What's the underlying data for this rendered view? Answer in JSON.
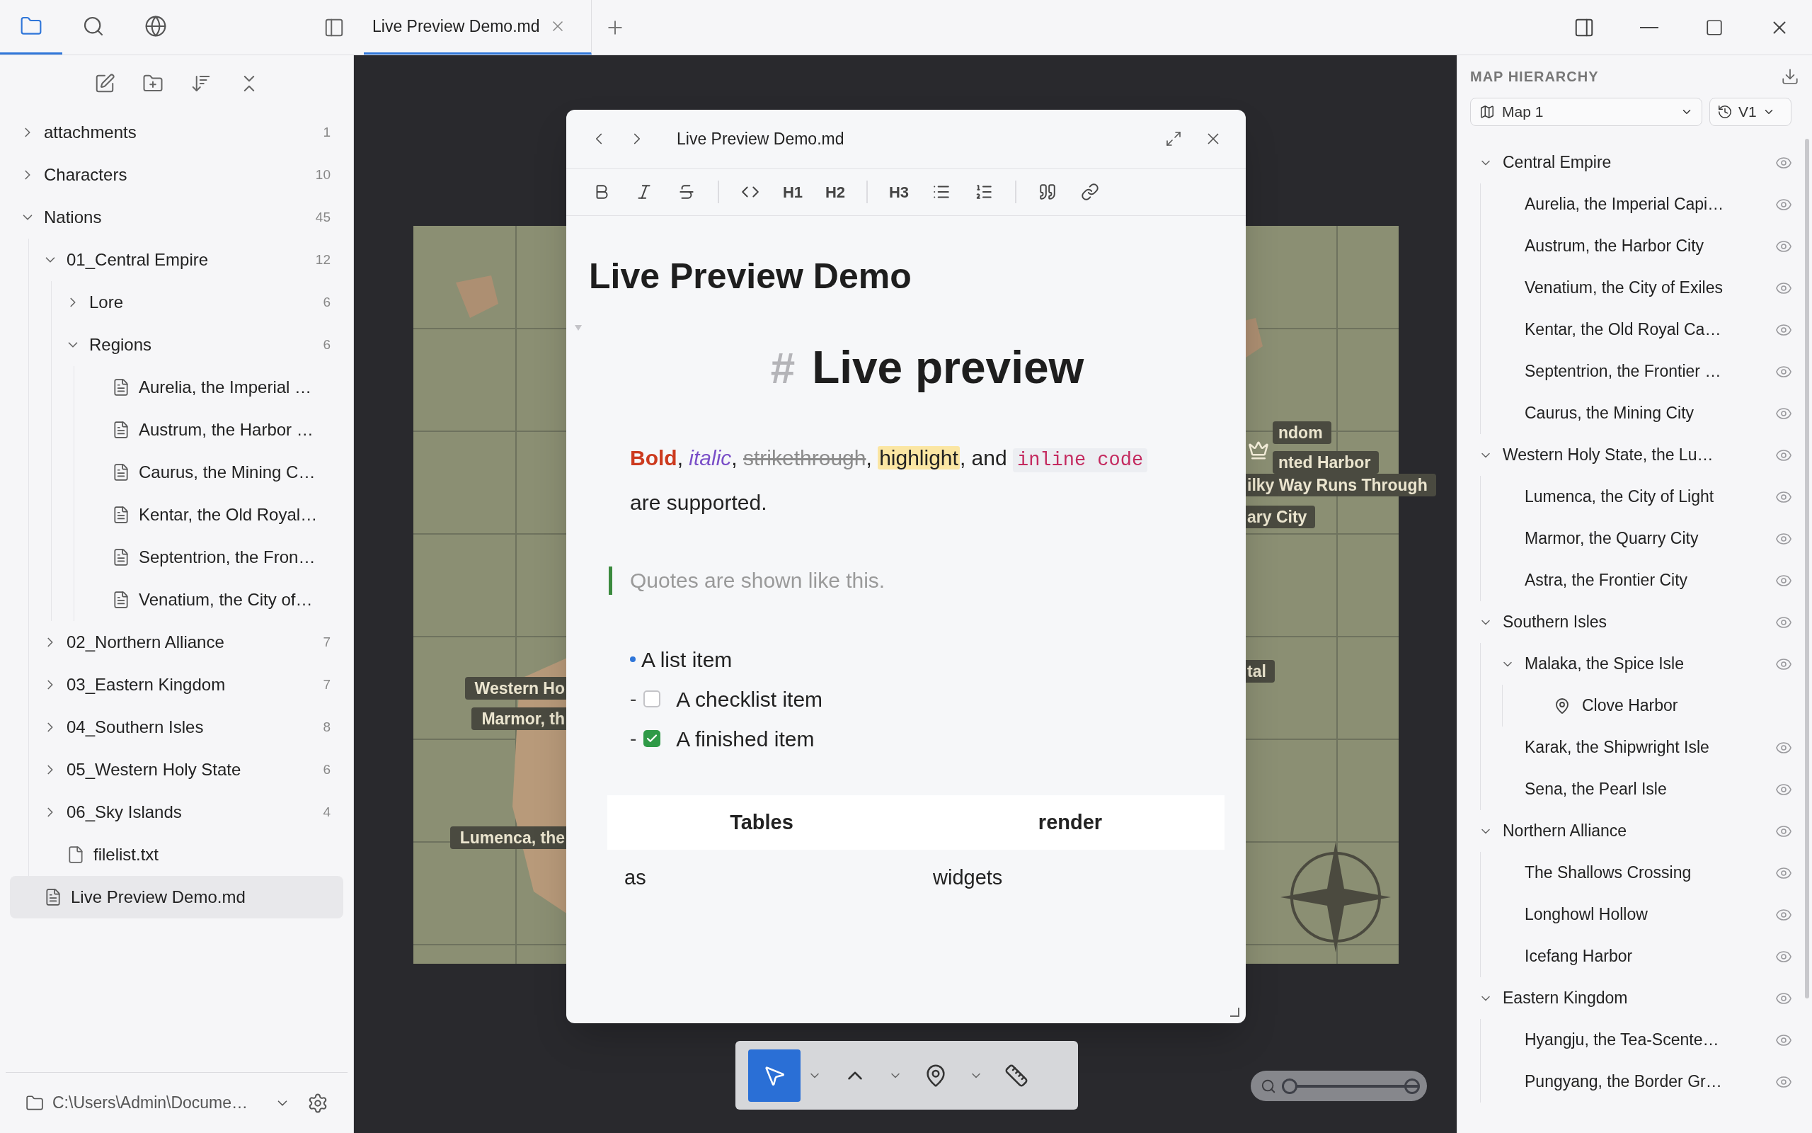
{
  "activity_bar": [
    {
      "kind": "files",
      "selected": true
    },
    {
      "kind": "search",
      "selected": false
    },
    {
      "kind": "web",
      "selected": false
    }
  ],
  "tabs": [
    {
      "label": "Live Preview Demo.md",
      "selected": true
    }
  ],
  "file_explorer": {
    "tree": [
      {
        "kind": "folder",
        "name": "attachments",
        "count": "1",
        "expanded": false,
        "selected": false
      },
      {
        "kind": "folder",
        "name": "Characters",
        "count": "10",
        "expanded": false,
        "selected": false
      },
      {
        "kind": "folder",
        "name": "Nations",
        "count": "45",
        "expanded": true,
        "selected": false,
        "children": [
          {
            "kind": "folder",
            "name": "01_Central Empire",
            "count": "12",
            "expanded": true,
            "selected": false,
            "children": [
              {
                "kind": "folder",
                "name": "Lore",
                "count": "6",
                "expanded": false,
                "selected": false
              },
              {
                "kind": "folder",
                "name": "Regions",
                "count": "6",
                "expanded": true,
                "selected": false,
                "children": [
                  {
                    "kind": "note",
                    "name": "Aurelia, the Imperial …",
                    "selected": false
                  },
                  {
                    "kind": "note",
                    "name": "Austrum, the Harbor …",
                    "selected": false
                  },
                  {
                    "kind": "note",
                    "name": "Caurus, the Mining C…",
                    "selected": false
                  },
                  {
                    "kind": "note",
                    "name": "Kentar, the Old Royal…",
                    "selected": false
                  },
                  {
                    "kind": "note",
                    "name": "Septentrion, the Fron…",
                    "selected": false
                  },
                  {
                    "kind": "note",
                    "name": "Venatium, the City of…",
                    "selected": false
                  }
                ]
              }
            ]
          },
          {
            "kind": "folder",
            "name": "02_Northern Alliance",
            "count": "7",
            "expanded": false,
            "selected": false
          },
          {
            "kind": "folder",
            "name": "03_Eastern Kingdom",
            "count": "7",
            "expanded": false,
            "selected": false
          },
          {
            "kind": "folder",
            "name": "04_Southern Isles",
            "count": "8",
            "expanded": false,
            "selected": false
          },
          {
            "kind": "folder",
            "name": "05_Western Holy State",
            "count": "6",
            "expanded": false,
            "selected": false
          },
          {
            "kind": "folder",
            "name": "06_Sky Islands",
            "count": "4",
            "expanded": false,
            "selected": false
          },
          {
            "kind": "file",
            "name": "filelist.txt",
            "selected": false
          }
        ]
      },
      {
        "kind": "note",
        "name": "Live Preview Demo.md",
        "selected": true
      }
    ],
    "vault_path": "C:\\Users\\Admin\\Docume…"
  },
  "map": {
    "labels": [
      "Western Ho",
      "Marmor, th",
      "Lumenca, the",
      "ndom",
      "nted Harbor",
      "ilky Way Runs Through",
      "ary City",
      "tal"
    ]
  },
  "editor": {
    "title": "Live Preview Demo.md",
    "toolbar": [
      {
        "kind": "bold"
      },
      {
        "kind": "italic"
      },
      {
        "kind": "strike"
      },
      {
        "kind": "divider"
      },
      {
        "kind": "code"
      },
      {
        "kind": "heading",
        "label": "H1"
      },
      {
        "kind": "heading",
        "label": "H2"
      },
      {
        "kind": "divider"
      },
      {
        "kind": "heading",
        "label": "H3"
      },
      {
        "kind": "bullets"
      },
      {
        "kind": "numbers"
      },
      {
        "kind": "divider"
      },
      {
        "kind": "quote"
      },
      {
        "kind": "link"
      }
    ],
    "note_title": "Live Preview Demo",
    "heading": {
      "mark": "#",
      "text": "Live preview"
    },
    "paragraph": [
      {
        "kind": "bold",
        "text": "Bold"
      },
      {
        "kind": "plain",
        "text": ", "
      },
      {
        "kind": "italic",
        "text": "italic"
      },
      {
        "kind": "plain",
        "text": ", "
      },
      {
        "kind": "strike",
        "text": "strikethrough"
      },
      {
        "kind": "plain",
        "text": ", "
      },
      {
        "kind": "highlight",
        "text": "highlight"
      },
      {
        "kind": "plain",
        "text": ", and "
      },
      {
        "kind": "code",
        "text": "inline code"
      },
      {
        "kind": "plain",
        "text": " are supported."
      }
    ],
    "quote": "Quotes are shown like this.",
    "list": [
      {
        "kind": "bullet",
        "text": "A list item"
      },
      {
        "kind": "task",
        "marker": "-",
        "text": "A checklist item",
        "checked": false
      },
      {
        "kind": "task",
        "marker": "-",
        "text": "A finished item",
        "checked": true
      }
    ],
    "table": {
      "columns": [
        "Tables",
        "render"
      ],
      "rows": [
        [
          "as",
          "widgets"
        ]
      ]
    }
  },
  "map_tools": [
    {
      "kind": "select",
      "selected": true
    },
    {
      "kind": "curve",
      "selected": false
    },
    {
      "kind": "pin",
      "selected": false
    },
    {
      "kind": "ruler",
      "selected": false
    }
  ],
  "zoom": {
    "level": 0
  },
  "map_hierarchy": {
    "title": "MAP HIERARCHY",
    "map": "Map 1",
    "version": "V1",
    "tree": [
      {
        "kind": "group",
        "name": "Central Empire",
        "expanded": true,
        "children": [
          {
            "kind": "place",
            "name": "Aurelia, the Imperial Capi…"
          },
          {
            "kind": "place",
            "name": "Austrum, the Harbor City"
          },
          {
            "kind": "place",
            "name": "Venatium, the City of Exiles"
          },
          {
            "kind": "place",
            "name": "Kentar, the Old Royal Ca…"
          },
          {
            "kind": "place",
            "name": "Septentrion, the Frontier …"
          },
          {
            "kind": "place",
            "name": "Caurus, the Mining City"
          }
        ]
      },
      {
        "kind": "group",
        "name": "Western Holy State, the Lu…",
        "expanded": true,
        "children": [
          {
            "kind": "place",
            "name": "Lumenca, the City of Light"
          },
          {
            "kind": "place",
            "name": "Marmor, the Quarry City"
          },
          {
            "kind": "place",
            "name": "Astra, the Frontier City"
          }
        ]
      },
      {
        "kind": "group",
        "name": "Southern Isles",
        "expanded": true,
        "children": [
          {
            "kind": "group",
            "name": "Malaka, the Spice Isle",
            "expanded": true,
            "children": [
              {
                "kind": "pin",
                "name": "Clove Harbor"
              }
            ]
          },
          {
            "kind": "place",
            "name": "Karak, the Shipwright Isle"
          },
          {
            "kind": "place",
            "name": "Sena, the Pearl Isle"
          }
        ]
      },
      {
        "kind": "group",
        "name": "Northern Alliance",
        "expanded": true,
        "children": [
          {
            "kind": "place",
            "name": "The Shallows Crossing"
          },
          {
            "kind": "place",
            "name": "Longhowl Hollow"
          },
          {
            "kind": "place",
            "name": "Icefang Harbor"
          }
        ]
      },
      {
        "kind": "group",
        "name": "Eastern Kingdom",
        "expanded": true,
        "children": [
          {
            "kind": "place",
            "name": "Hyangju, the Tea-Scente…"
          },
          {
            "kind": "place",
            "name": "Pungyang, the Border Gr…"
          }
        ]
      }
    ]
  }
}
